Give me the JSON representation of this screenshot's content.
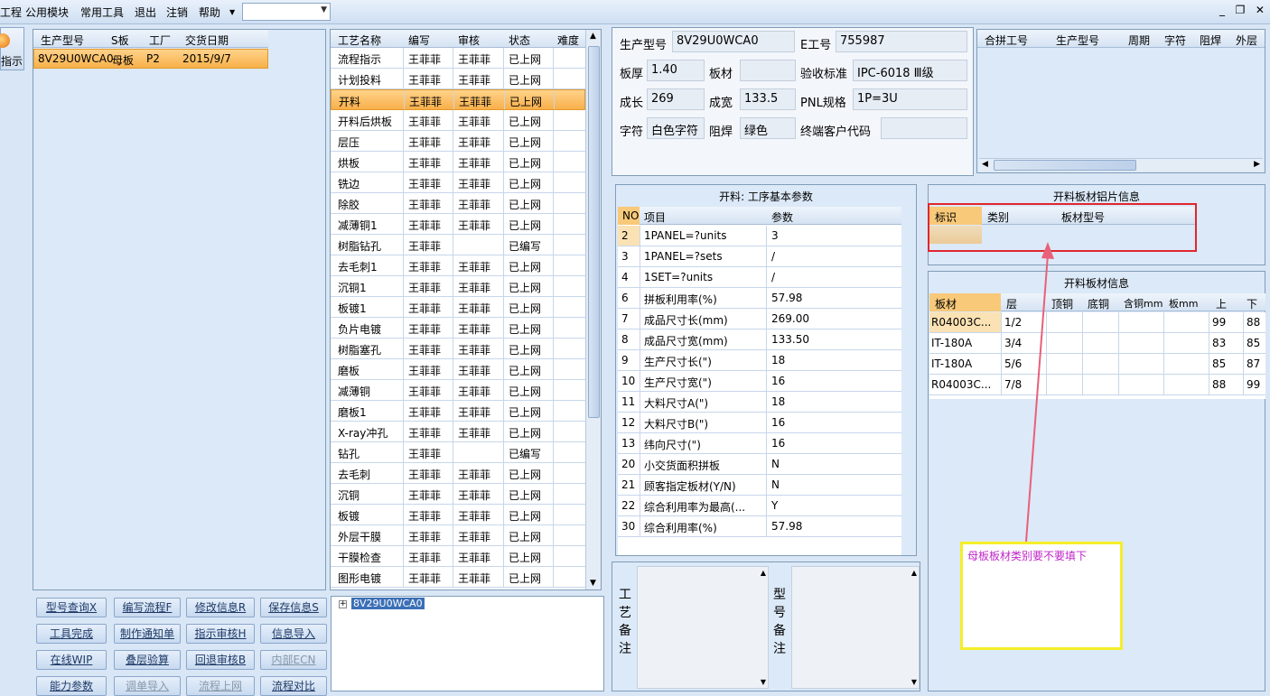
{
  "menu": {
    "items": [
      "工程",
      "公用模块",
      "常用工具",
      "退出",
      "注销",
      "帮助"
    ],
    "dropdown_value": ""
  },
  "left_nav": {
    "label": "指示"
  },
  "orders_grid": {
    "columns": [
      "生产型号",
      "S板",
      "工厂",
      "交货日期"
    ],
    "rows": [
      [
        "8V29U0WCA0",
        "母板",
        "P2",
        "2015/9/7"
      ]
    ]
  },
  "process_grid": {
    "columns": [
      "工艺名称",
      "编写",
      "审核",
      "状态",
      "难度"
    ],
    "rows": [
      [
        "流程指示",
        "王菲菲",
        "王菲菲",
        "已上网"
      ],
      [
        "计划投料",
        "王菲菲",
        "王菲菲",
        "已上网"
      ],
      [
        "开料",
        "王菲菲",
        "王菲菲",
        "已上网"
      ],
      [
        "开料后烘板",
        "王菲菲",
        "王菲菲",
        "已上网"
      ],
      [
        "层压",
        "王菲菲",
        "王菲菲",
        "已上网"
      ],
      [
        "烘板",
        "王菲菲",
        "王菲菲",
        "已上网"
      ],
      [
        "铣边",
        "王菲菲",
        "王菲菲",
        "已上网"
      ],
      [
        "除胶",
        "王菲菲",
        "王菲菲",
        "已上网"
      ],
      [
        "减薄铜1",
        "王菲菲",
        "王菲菲",
        "已上网"
      ],
      [
        "树脂钻孔",
        "王菲菲",
        "",
        "已编写"
      ],
      [
        "去毛刺1",
        "王菲菲",
        "王菲菲",
        "已上网"
      ],
      [
        "沉铜1",
        "王菲菲",
        "王菲菲",
        "已上网"
      ],
      [
        "板镀1",
        "王菲菲",
        "王菲菲",
        "已上网"
      ],
      [
        "负片电镀",
        "王菲菲",
        "王菲菲",
        "已上网"
      ],
      [
        "树脂塞孔",
        "王菲菲",
        "王菲菲",
        "已上网"
      ],
      [
        "磨板",
        "王菲菲",
        "王菲菲",
        "已上网"
      ],
      [
        "减薄铜",
        "王菲菲",
        "王菲菲",
        "已上网"
      ],
      [
        "磨板1",
        "王菲菲",
        "王菲菲",
        "已上网"
      ],
      [
        "X-ray冲孔",
        "王菲菲",
        "王菲菲",
        "已上网"
      ],
      [
        "钻孔",
        "王菲菲",
        "",
        "已编写"
      ],
      [
        "去毛刺",
        "王菲菲",
        "王菲菲",
        "已上网"
      ],
      [
        "沉铜",
        "王菲菲",
        "王菲菲",
        "已上网"
      ],
      [
        "板镀",
        "王菲菲",
        "王菲菲",
        "已上网"
      ],
      [
        "外层干膜",
        "王菲菲",
        "王菲菲",
        "已上网"
      ],
      [
        "干膜检查",
        "王菲菲",
        "王菲菲",
        "已上网"
      ],
      [
        "图形电镀",
        "王菲菲",
        "王菲菲",
        "已上网"
      ]
    ]
  },
  "buttons": [
    [
      "型号查询X",
      "编写流程F",
      "修改信息R",
      "保存信息S"
    ],
    [
      "工具完成",
      "制作通知单",
      "指示审核H",
      "信息导入"
    ],
    [
      "在线WIP",
      "叠层验算",
      "回退审核B",
      "内部ECN"
    ],
    [
      "能力参数",
      "调单导入",
      "流程上网",
      "流程对比"
    ]
  ],
  "tree": {
    "node": "8V29U0WCA0"
  },
  "info": {
    "model_label": "生产型号",
    "model_value": "8V29U0WCA0",
    "eno_label": "E工号",
    "eno_value": "755987",
    "thickness_label": "板厚",
    "thickness_value": "1.40",
    "material_label": "板材",
    "material_value": "",
    "standard_label": "验收标准",
    "standard_value": "IPC-6018 Ⅲ级",
    "length_label": "成长",
    "length_value": "269",
    "width_label": "成宽",
    "width_value": "133.5",
    "pnl_label": "PNL规格",
    "pnl_value": "1P=3U",
    "char_label": "字符",
    "char_value": "白色字符",
    "mask_label": "阻焊",
    "mask_value": "绿色",
    "customer_label": "终端客户代码",
    "customer_value": ""
  },
  "combine_grid": {
    "columns": [
      "合拼工号",
      "生产型号",
      "周期",
      "字符",
      "阻焊",
      "外层"
    ]
  },
  "params": {
    "title": "开料: 工序基本参数",
    "columns": [
      "NO",
      "项目",
      "参数"
    ],
    "rows": [
      [
        "2",
        "1PANEL=?units",
        "3"
      ],
      [
        "3",
        "1PANEL=?sets",
        "/"
      ],
      [
        "4",
        "1SET=?units",
        "/"
      ],
      [
        "6",
        "拼板利用率(%)",
        "57.98"
      ],
      [
        "7",
        "成品尺寸长(mm)",
        "269.00"
      ],
      [
        "8",
        "成品尺寸宽(mm)",
        "133.50"
      ],
      [
        "9",
        "生产尺寸长(\")",
        "18"
      ],
      [
        "10",
        "生产尺寸宽(\")",
        "16"
      ],
      [
        "11",
        "大料尺寸A(\")",
        "18"
      ],
      [
        "12",
        "大料尺寸B(\")",
        "16"
      ],
      [
        "13",
        "纬向尺寸(\")",
        "16"
      ],
      [
        "20",
        "小交货面积拼板",
        "N"
      ],
      [
        "21",
        "顾客指定板材(Y/N)",
        "N"
      ],
      [
        "22",
        "综合利用率为最高(...",
        "Y"
      ],
      [
        "30",
        "综合利用率(%)",
        "57.98"
      ]
    ]
  },
  "foil": {
    "title": "开料板材铝片信息",
    "columns": [
      "标识",
      "类别",
      "板材型号"
    ]
  },
  "sheets": {
    "title": "开料板材信息",
    "columns": [
      "板材",
      "层",
      "顶铜",
      "底铜",
      "含铜mm",
      "板mm",
      "上",
      "下"
    ],
    "rows": [
      [
        "R04003C...",
        "1/2",
        "",
        "",
        "",
        "",
        "99",
        "88"
      ],
      [
        "IT-180A",
        "3/4",
        "",
        "",
        "",
        "",
        "83",
        "85"
      ],
      [
        "IT-180A",
        "5/6",
        "",
        "",
        "",
        "",
        "85",
        "87"
      ],
      [
        "R04003C...",
        "7/8",
        "",
        "",
        "",
        "",
        "88",
        "99"
      ]
    ]
  },
  "remarks": {
    "process_label": "工艺备注",
    "model_label": "型号备注"
  },
  "annotation": {
    "text": "母板板材类别要不要填下"
  }
}
